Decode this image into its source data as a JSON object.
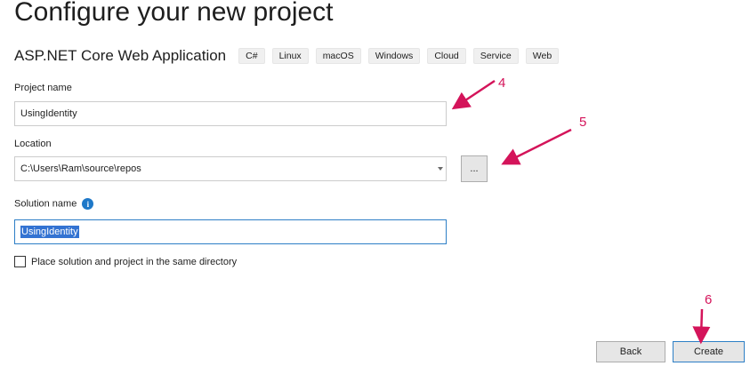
{
  "page": {
    "title": "Configure your new project",
    "subtitle": "ASP.NET Core Web Application"
  },
  "tags": [
    "C#",
    "Linux",
    "macOS",
    "Windows",
    "Cloud",
    "Service",
    "Web"
  ],
  "form": {
    "project_name_label": "Project name",
    "project_name_value": "UsingIdentity",
    "location_label": "Location",
    "location_value": "C:\\Users\\Ram\\source\\repos",
    "browse_label": "...",
    "solution_name_label": "Solution name",
    "solution_name_value": "UsingIdentity",
    "info_icon": "i",
    "same_dir_label": "Place solution and project in the same directory",
    "same_dir_checked": false
  },
  "buttons": {
    "back_label": "Back",
    "create_label": "Create"
  },
  "annotations": {
    "n4": "4",
    "n5": "5",
    "n6": "6",
    "color": "#d4145a"
  }
}
